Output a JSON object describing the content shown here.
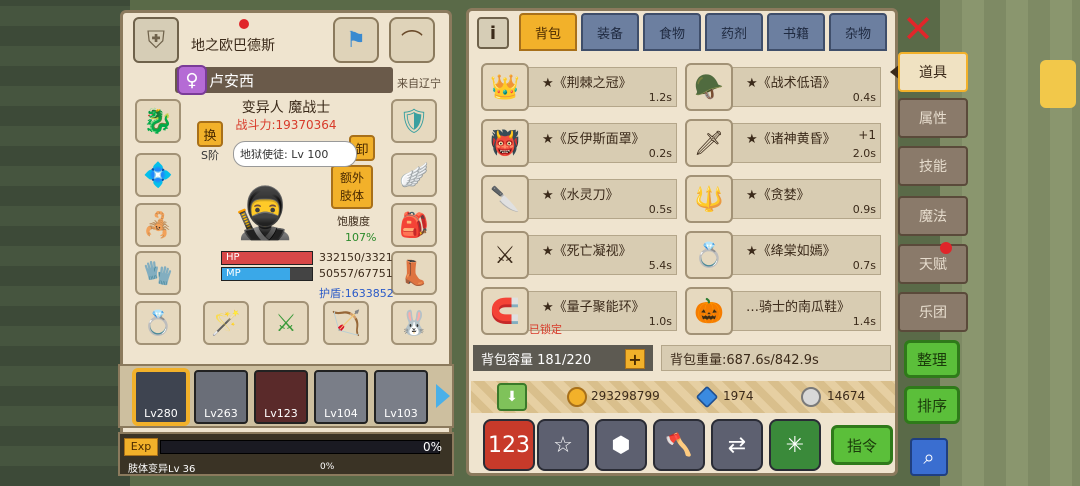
{
  "player": {
    "guild_name": "地之欧巴德斯",
    "name": "卢安西",
    "gender_symbol": "♀",
    "origin": "来自辽宁",
    "class_line": "变异人 魔战士",
    "power_label": "战斗力:",
    "power_value": "19370364",
    "swap_label": "换",
    "unequip_label": "卸",
    "extra_limb_label_1": "额外",
    "extra_limb_label_2": "肢体",
    "title_prefix": "S阶",
    "title": "地狱使徒: Lv 100",
    "satiety_label": "饱腹度",
    "satiety_value": "107%",
    "hp_label": "HP",
    "hp_value": "332150/3321",
    "hp_ratio": 1.0,
    "mp_label": "MP",
    "mp_value": "50557/67751",
    "mp_ratio": 0.75,
    "shield_text": "护盾:1633852"
  },
  "heroes": [
    {
      "level": "Lv280",
      "icon": "dark-hero",
      "active": true
    },
    {
      "level": "Lv263",
      "icon": "grey-hero",
      "active": false
    },
    {
      "level": "Lv123",
      "icon": "pirate-hero",
      "active": false
    },
    {
      "level": "Lv104",
      "icon": "grey-girl-hero",
      "active": false
    },
    {
      "level": "Lv103",
      "icon": "grey-girl-hero",
      "active": false
    }
  ],
  "exp": {
    "label": "Exp",
    "percent": "0%",
    "sub_label": "肢体变异Lv 36",
    "sub_percent": "0%"
  },
  "inventory": {
    "tabs": [
      "背包",
      "装备",
      "食物",
      "药剂",
      "书籍",
      "杂物"
    ],
    "active_tab": 0,
    "items": [
      {
        "name": "★《荆棘之冠》",
        "weight": "1.2s",
        "icon": "thorn-crown-icon",
        "emoji": "👑"
      },
      {
        "name": "★《战术低语》",
        "weight": "0.4s",
        "icon": "tactical-helmet-icon",
        "emoji": "🪖"
      },
      {
        "name": "★《反伊斯面罩》",
        "weight": "0.2s",
        "icon": "demon-mask-icon",
        "emoji": "👹"
      },
      {
        "name": "★《诸神黄昏》",
        "weight": "2.0s",
        "icon": "purple-sword-icon",
        "emoji": "🗡",
        "plus": "+1"
      },
      {
        "name": "★《水灵刀》",
        "weight": "0.5s",
        "icon": "water-blade-icon",
        "emoji": "🔪"
      },
      {
        "name": "★《贪婪》",
        "weight": "0.9s",
        "icon": "greed-spear-icon",
        "emoji": "🔱"
      },
      {
        "name": "★《死亡凝视》",
        "weight": "5.4s",
        "icon": "death-gaze-icon",
        "emoji": "⚔"
      },
      {
        "name": "★《绛棠如嫣》",
        "weight": "0.7s",
        "icon": "ring-icon",
        "emoji": "💍"
      },
      {
        "name": "★《量子聚能环》",
        "weight": "1.0s",
        "icon": "quantum-ring-icon",
        "emoji": "🧲"
      },
      {
        "name": "…骑士的南瓜鞋》",
        "weight": "1.4s",
        "icon": "pumpkin-shoes-icon",
        "emoji": "🎃"
      }
    ],
    "locked_label": "已锁定",
    "capacity": "背包容量 181/220",
    "weight": "背包重量:687.6s/842.9s",
    "gold": "293298799",
    "diamonds": "1974",
    "silver": "14674",
    "command_label": "指令"
  },
  "side_menu": {
    "items": [
      "道具",
      "属性",
      "技能",
      "魔法",
      "天赋",
      "乐团"
    ],
    "active": 0,
    "organize_label": "整理",
    "sort_label": "排序"
  },
  "colors": {
    "accent": "#f2b12a",
    "panel": "#efe4cf",
    "green": "#5bbf3a",
    "red": "#e0262a"
  }
}
